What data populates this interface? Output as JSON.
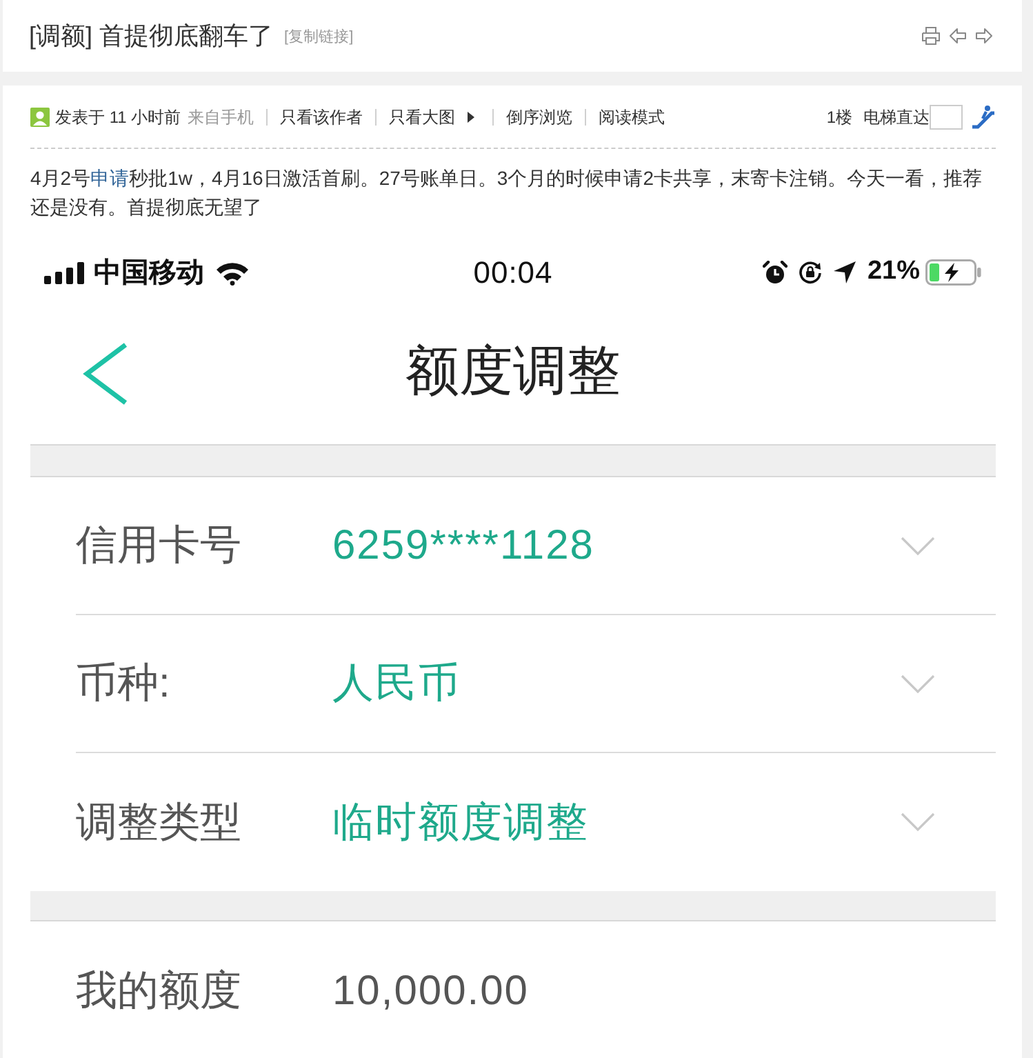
{
  "header": {
    "title": "[调额] 首提彻底翻车了",
    "copy_link": "[复制链接]"
  },
  "post": {
    "meta": {
      "posted": "发表于 11 小时前",
      "source": "来自手机",
      "actions": [
        {
          "label": "只看该作者",
          "kind": "link"
        },
        {
          "label": "只看大图",
          "kind": "menu"
        },
        {
          "label": "倒序浏览",
          "kind": "link"
        },
        {
          "label": "阅读模式",
          "kind": "link"
        }
      ],
      "floor": "1楼",
      "jump_label": "电梯直达"
    },
    "body": [
      {
        "text": "4月2号",
        "kind": "text"
      },
      {
        "text": "申请",
        "kind": "link"
      },
      {
        "text": "秒批1w，4月16日激活首刷。27号账单日。3个月的时候申请2卡共享，末寄卡注销。今天一看，推荐还是没有。首提彻底无望了",
        "kind": "text"
      }
    ],
    "screenshot": {
      "status_bar": {
        "carrier": "中国移动",
        "time": "00:04",
        "battery": "21%"
      },
      "nav": {
        "title": "额度调整"
      },
      "sections": [
        {
          "rows": [
            {
              "label": "信用卡号",
              "value": "6259****1128",
              "kind": "select"
            },
            {
              "label": "币种:",
              "value": "人民币",
              "kind": "select"
            },
            {
              "label": "调整类型",
              "value": "临时额度调整",
              "kind": "select"
            }
          ]
        },
        {
          "rows": [
            {
              "label": "我的额度",
              "value": "10,000.00",
              "kind": "display"
            }
          ]
        }
      ]
    }
  }
}
